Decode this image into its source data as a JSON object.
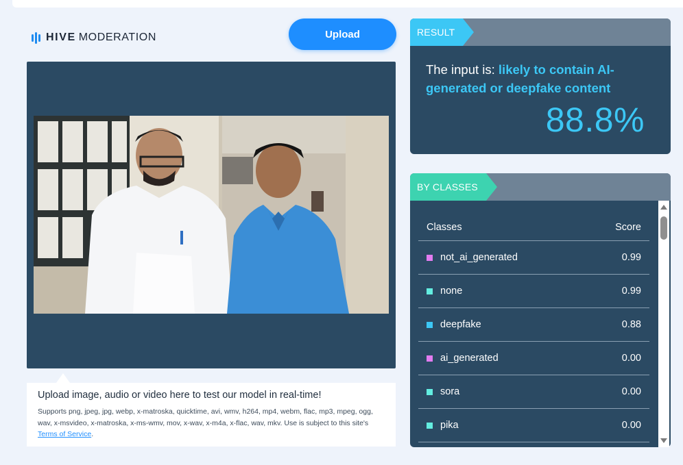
{
  "brand": {
    "bold": "HIVE",
    "light": "MODERATION",
    "logo_icon": "hive-bars-icon",
    "color": "#1e8bf0"
  },
  "upload": {
    "label": "Upload",
    "color": "#1e8eff"
  },
  "media": {
    "icon": "video-frame"
  },
  "info": {
    "title": "Upload image, audio or video here to test our model in real-time!",
    "supports": "Supports png, jpeg, jpg, webp, x-matroska, quicktime, avi, wmv, h264, mp4, webm, flac, mp3, mpeg, ogg, wav, x-msvideo, x-matroska, x-ms-wmv, mov, x-wav, x-m4a, x-flac, wav, mkv. Use is subject to this site's ",
    "terms_link": "Terms of Service",
    "period": "."
  },
  "result": {
    "tab": "RESULT",
    "prefix": "The input is: ",
    "verdict": "likely to contain AI-generated or deepfake content",
    "percent": "88.8%",
    "accent": "#3cc7f5"
  },
  "classes": {
    "tab": "BY CLASSES",
    "header": {
      "class": "Classes",
      "score": "Score"
    },
    "rows": [
      {
        "name": "not_ai_generated",
        "score": "0.99",
        "color": "#e27cf0"
      },
      {
        "name": "none",
        "score": "0.99",
        "color": "#63ede0"
      },
      {
        "name": "deepfake",
        "score": "0.88",
        "color": "#3cc7f5"
      },
      {
        "name": "ai_generated",
        "score": "0.00",
        "color": "#e27cf0"
      },
      {
        "name": "sora",
        "score": "0.00",
        "color": "#63ede0"
      },
      {
        "name": "pika",
        "score": "0.00",
        "color": "#63ede0"
      }
    ]
  }
}
